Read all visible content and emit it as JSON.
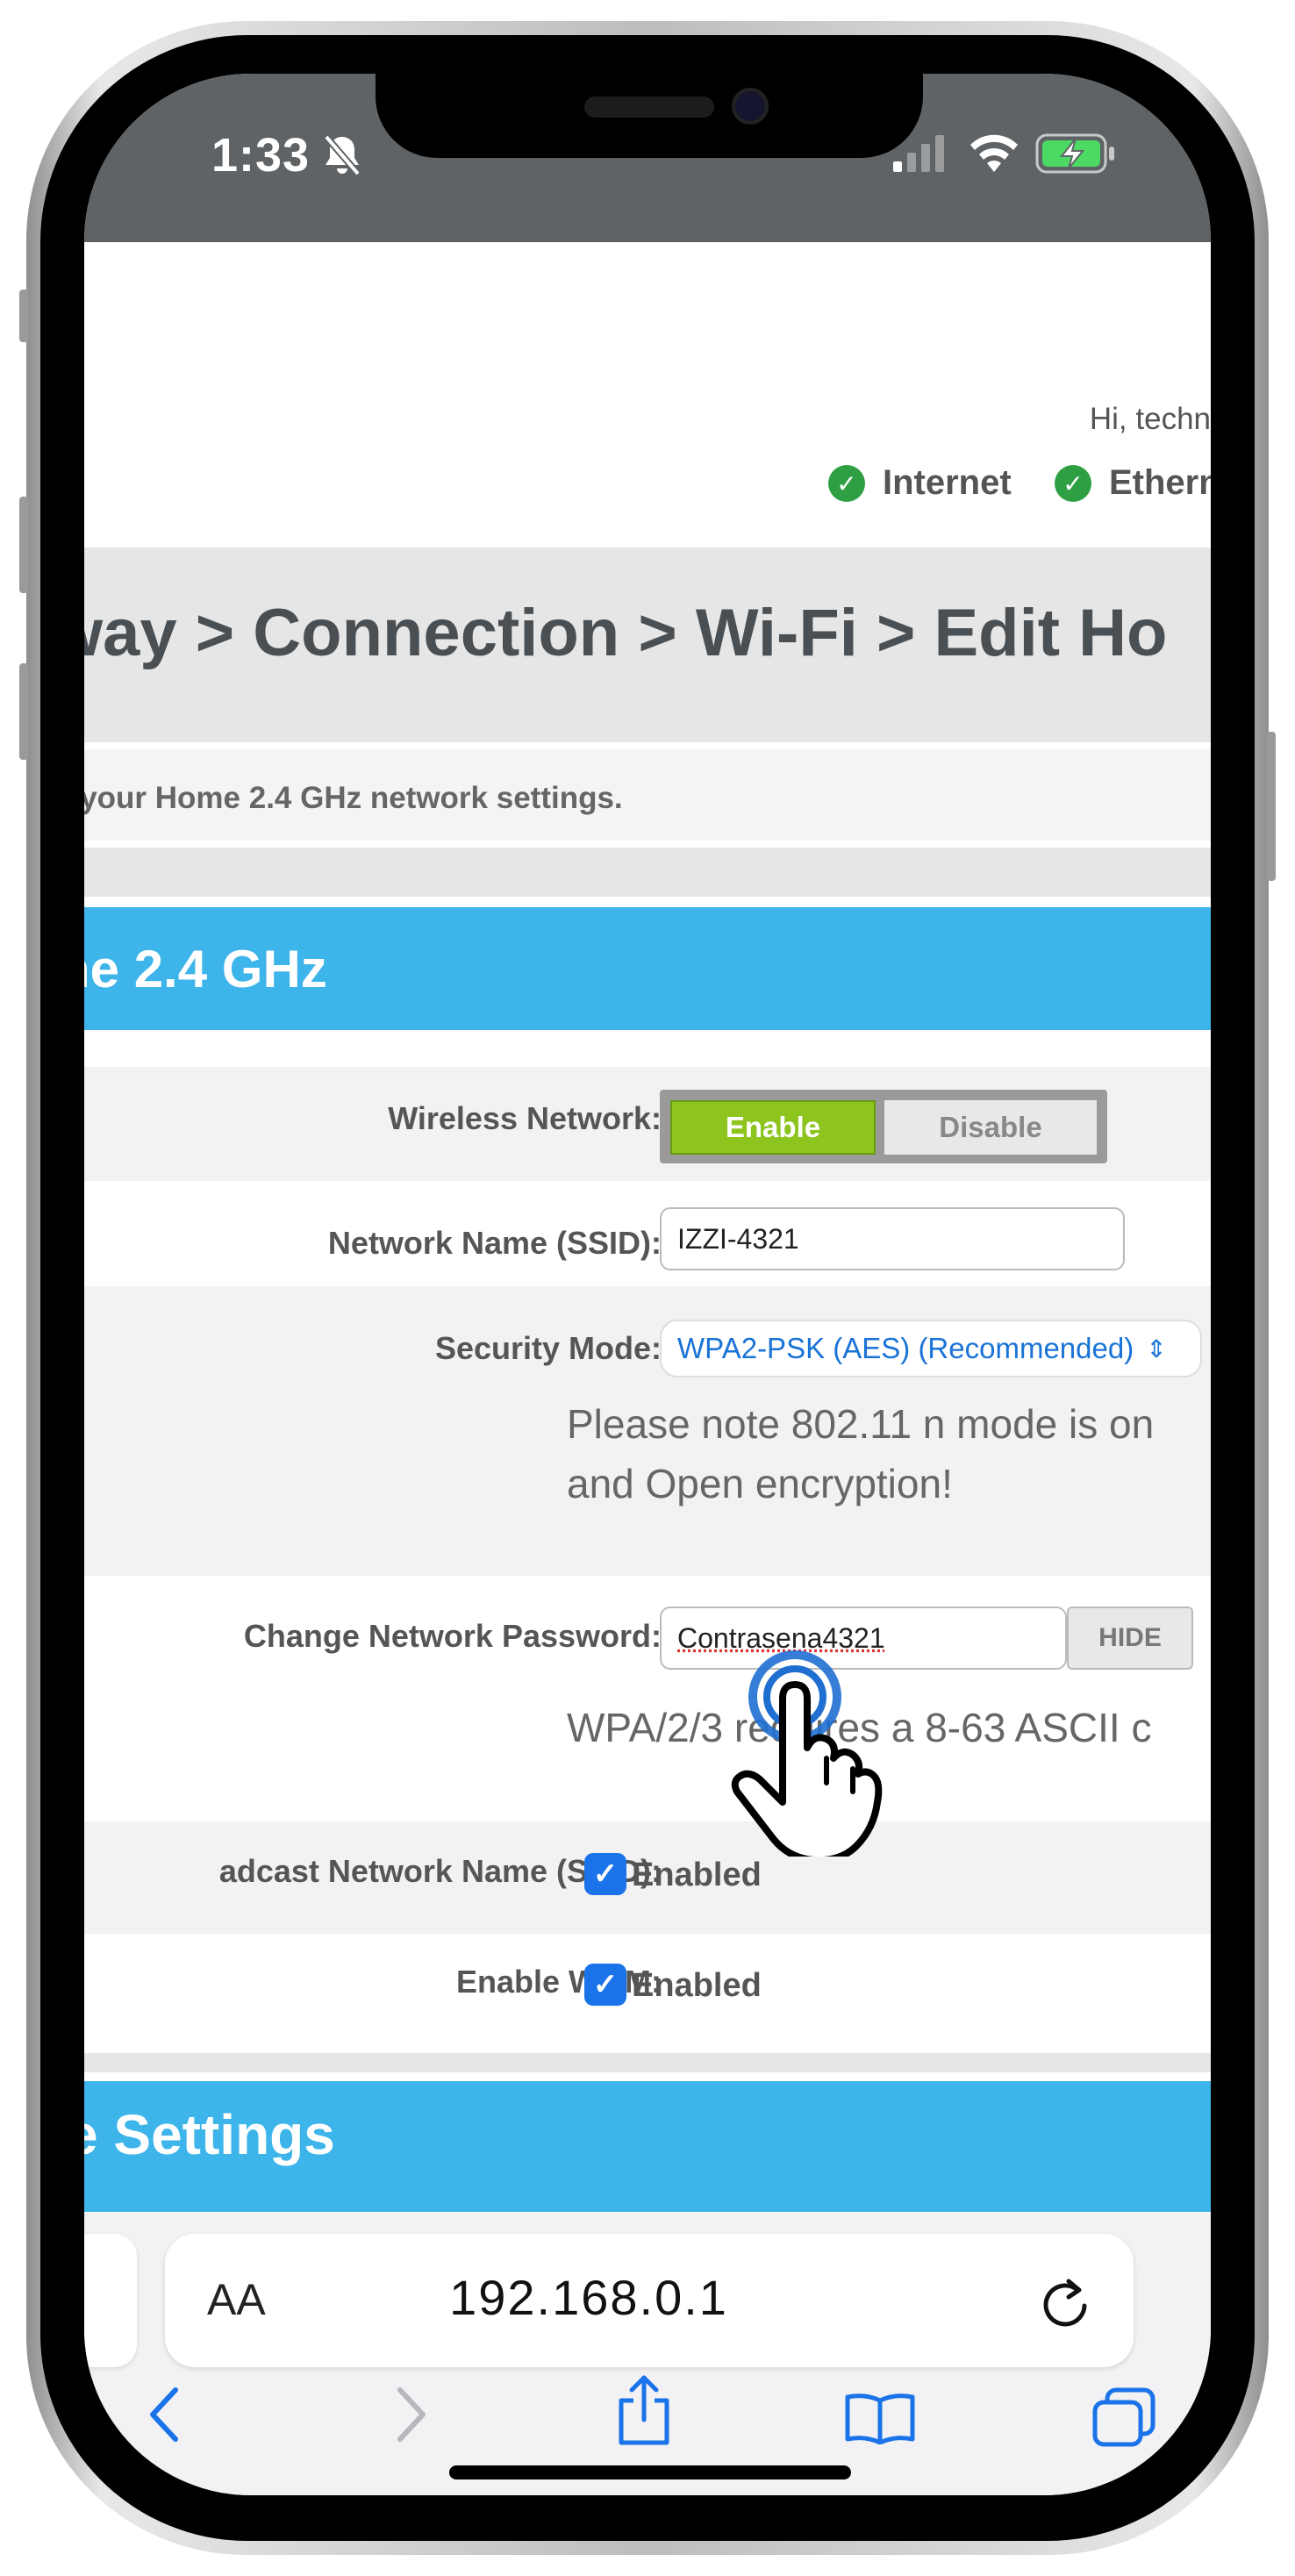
{
  "status_bar": {
    "time": "1:33"
  },
  "header": {
    "greeting": "Hi, techn",
    "status_internet": "Internet",
    "status_ethernet": "Ethern"
  },
  "breadcrumb": "way > Connection > Wi-Fi > Edit Ho",
  "description": "e your Home 2.4 GHz network settings.",
  "section_title": "ne 2.4 GHz",
  "form": {
    "wireless_label": "Wireless Network:",
    "enable_label": "Enable",
    "disable_label": "Disable",
    "ssid_label": "Network Name (SSID):",
    "ssid_value": "IZZI-4321",
    "security_label": "Security Mode:",
    "security_value": "WPA2-PSK (AES) (Recommended)",
    "note_line1": "Please note 802.11 n mode is on",
    "note_line2": "and Open encryption!",
    "password_label": "Change Network Password:",
    "password_value": "Contrasena4321",
    "hide_label": "HIDE",
    "password_hint": "WPA/2/3 requires a 8-63 ASCII c",
    "broadcast_label": "adcast Network Name (SSID):",
    "broadcast_value": "Enabled",
    "wmm_label": "Enable WMM:",
    "wmm_value": "Enabled"
  },
  "section2_title": "e Settings",
  "safari": {
    "text_size_label": "AA",
    "url": "192.168.0.1"
  },
  "colors": {
    "accent_blue": "#3db4ea",
    "enable_green": "#8dc41d",
    "status_bar": "#5f6366"
  },
  "icons": [
    "bell-slash-icon",
    "signal-icon",
    "wifi-icon",
    "battery-charging-icon",
    "check-circle-icon",
    "chevron-updown-icon",
    "tap-hand-icon",
    "reload-icon",
    "back-icon",
    "forward-icon",
    "share-icon",
    "bookmarks-icon",
    "tabs-icon"
  ]
}
